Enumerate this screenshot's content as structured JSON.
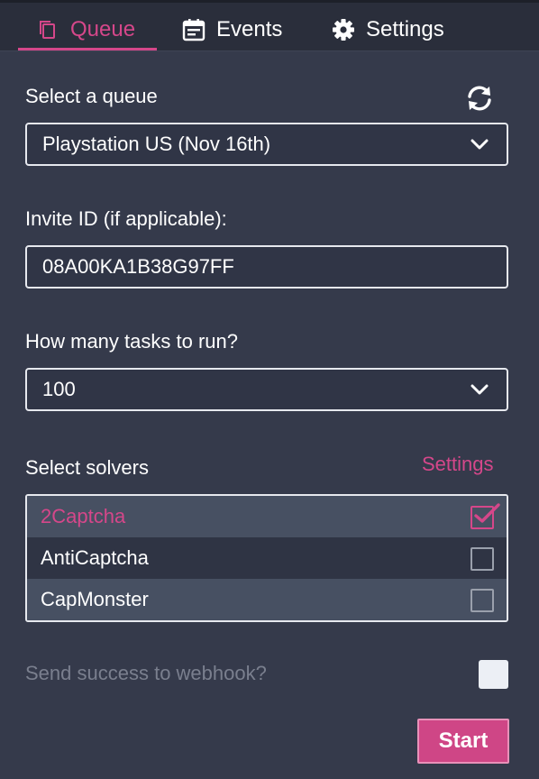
{
  "tabs": [
    {
      "label": "Queue",
      "icon": "copy-icon",
      "active": true
    },
    {
      "label": "Events",
      "icon": "calendar-icon",
      "active": false
    },
    {
      "label": "Settings",
      "icon": "gear-icon",
      "active": false
    }
  ],
  "queue": {
    "label": "Select a queue",
    "selected": "Playstation US (Nov 16th)"
  },
  "invite": {
    "label": "Invite ID (if applicable):",
    "value": "08A00KA1B38G97FF"
  },
  "tasks": {
    "label": "How many tasks to run?",
    "selected": "100"
  },
  "solvers": {
    "label": "Select solvers",
    "settings_link": "Settings",
    "items": [
      {
        "name": "2Captcha",
        "checked": true
      },
      {
        "name": "AntiCaptcha",
        "checked": false
      },
      {
        "name": "CapMonster",
        "checked": false
      }
    ]
  },
  "webhook": {
    "label": "Send success to webhook?",
    "checked": false
  },
  "start_label": "Start",
  "colors": {
    "accent": "#d5478a",
    "background": "#353a4b",
    "topbar": "#2a2e3b"
  }
}
